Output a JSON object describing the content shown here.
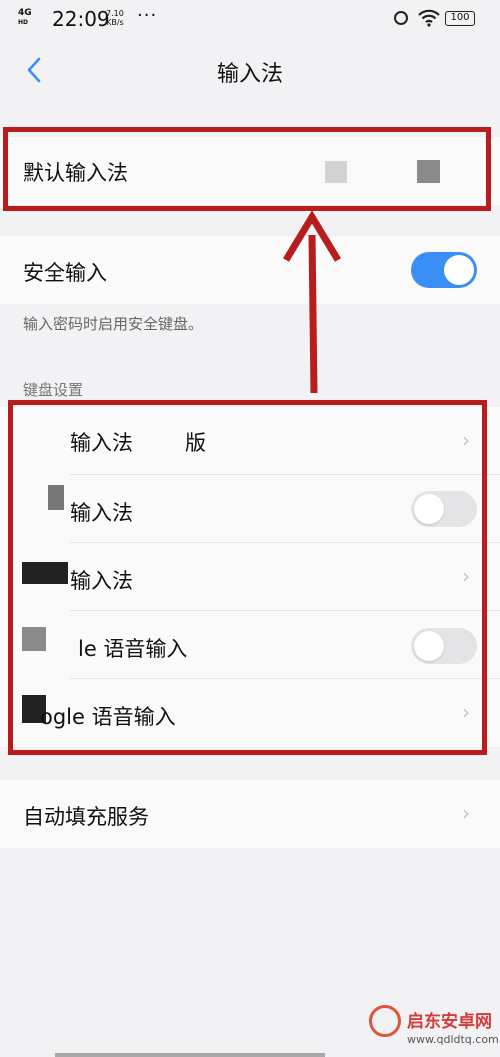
{
  "status_bar": {
    "network": "4G",
    "hd": "HD",
    "time": "22:09",
    "speed_value": "7.10",
    "speed_unit": "KB/s",
    "more": "···",
    "battery": "100"
  },
  "header": {
    "title": "输入法"
  },
  "default_input": {
    "label": "默认输入法"
  },
  "secure_input": {
    "label": "安全输入",
    "enabled": true,
    "hint": "输入密码时启用安全键盘。"
  },
  "keyboard_settings": {
    "section_title": "键盘设置",
    "items": [
      {
        "prefix": "输入法",
        "suffix": "版",
        "control": "chevron"
      },
      {
        "prefix": "输入法",
        "suffix": "",
        "control": "toggle",
        "enabled": false
      },
      {
        "prefix": "输入法",
        "suffix": "",
        "control": "chevron"
      },
      {
        "prefix": "le 语音输入",
        "suffix": "",
        "control": "toggle",
        "enabled": false
      },
      {
        "prefix": "ogle 语音输入",
        "suffix": "",
        "control": "chevron"
      }
    ]
  },
  "autofill": {
    "label": "自动填充服务"
  },
  "watermark": {
    "name": "启东安卓网",
    "url": "www.qdldtq.com"
  },
  "colors": {
    "accent": "#3a8ef6",
    "highlight_border": "#b81c1c",
    "background": "#f2f2f4"
  }
}
